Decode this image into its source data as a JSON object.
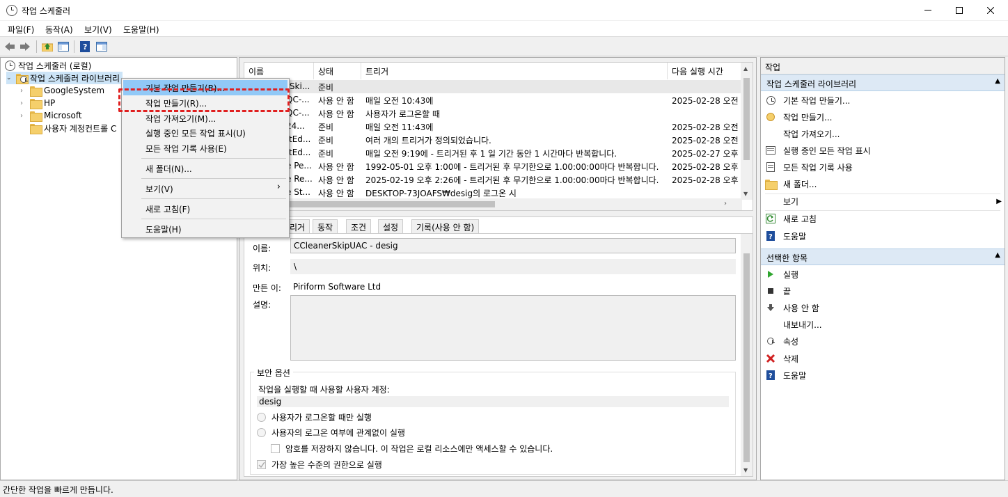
{
  "window": {
    "title": "작업 스케줄러"
  },
  "menu": [
    "파일(F)",
    "동작(A)",
    "보기(V)",
    "도움말(H)"
  ],
  "tree": {
    "root": "작업 스케줄러 (로컬)",
    "library": "작업 스케줄러 라이브러리",
    "children": [
      "GoogleSystem",
      "HP",
      "Microsoft",
      "사용자 계정컨트롤 C"
    ]
  },
  "context_menu": {
    "items": [
      "기본 작업 만들기(B)...",
      "작업 만들기(R)...",
      "작업 가져오기(M)...",
      "실행 중인 모든 작업 표시(U)",
      "모든 작업 기록 사용(E)",
      "새 폴더(N)...",
      "보기(V)",
      "새로 고침(F)",
      "도움말(H)"
    ],
    "submenu_arrow": "›"
  },
  "task_list": {
    "columns": [
      "이름",
      "상태",
      "트리거",
      "다음 실행 시간"
    ],
    "rows": [
      {
        "name": "rSki...",
        "status": "준비",
        "trigger": "",
        "next": ""
      },
      {
        "name": "QC-...",
        "status": "사용 안 함",
        "trigger": "매일 오전 10:43에",
        "next": "2025-02-28 오전"
      },
      {
        "name": "QC-...",
        "status": "사용 안 함",
        "trigger": "사용자가 로그온할 때",
        "next": ""
      },
      {
        "name": "24...",
        "status": "준비",
        "trigger": "매일 오전 11:43에",
        "next": "2025-02-28 오전"
      },
      {
        "name": "ftEd...",
        "status": "준비",
        "trigger": "여러 개의 트리거가 정의되었습니다.",
        "next": "2025-02-28 오전"
      },
      {
        "name": "ftEd...",
        "status": "준비",
        "trigger": "매일 오전 9:19에 - 트리거된 후 1 일 기간 동안 1 시간마다 반복합니다.",
        "next": "2025-02-27 오후"
      },
      {
        "name": "e Pe...",
        "status": "사용 안 함",
        "trigger": "1992-05-01 오후 1:00에 - 트리거된 후 무기한으로 1.00:00:00마다 반복합니다.",
        "next": "2025-02-28 오후"
      },
      {
        "name": "e Re...",
        "status": "사용 안 함",
        "trigger": "2025-02-19 오후 2:26에 - 트리거된 후 무기한으로 1.00:00:00마다 반복합니다.",
        "next": "2025-02-28 오후"
      },
      {
        "name": "e St...",
        "status": "사용 안 함",
        "trigger": "DESKTOP-73JOAFS₩desig의 로그온 시",
        "next": ""
      }
    ]
  },
  "detail_tabs": [
    "리거",
    "동작",
    "조건",
    "설정",
    "기록(사용 안 함)"
  ],
  "details": {
    "name_label": "이름:",
    "name_value": "CCleanerSkipUAC - desig",
    "location_label": "위치:",
    "location_value": "\\",
    "author_label": "만든 이:",
    "author_value": "Piriform Software Ltd",
    "description_label": "설명:",
    "security_title": "보안 옵션",
    "account_label": "작업을 실행할 때 사용할 사용자 계정:",
    "account_value": "desig",
    "radio1": "사용자가 로그온할 때만 실행",
    "radio2": "사용자의 로그온 여부에 관계없이 실행",
    "check1": "암호를 저장하지 않습니다. 이 작업은 로컬 리소스에만 액세스할 수 있습니다.",
    "check2": "가장 높은 수준의 권한으로 실행"
  },
  "actions": {
    "header": "작업",
    "section1": "작업 스케줄러 라이브러리",
    "section1_items": [
      {
        "label": "기본 작업 만들기...",
        "icon": "basic-task-icon"
      },
      {
        "label": "작업 만들기...",
        "icon": "create-task-icon"
      },
      {
        "label": "작업 가져오기...",
        "icon": ""
      },
      {
        "label": "실행 중인 모든 작업 표시",
        "icon": "running-tasks-icon"
      },
      {
        "label": "모든 작업 기록 사용",
        "icon": "history-icon"
      },
      {
        "label": "새 폴더...",
        "icon": "new-folder-icon"
      },
      {
        "label": "보기",
        "icon": ""
      },
      {
        "label": "새로 고침",
        "icon": "refresh-icon"
      },
      {
        "label": "도움말",
        "icon": "help-icon"
      }
    ],
    "section2": "선택한 항목",
    "section2_items": [
      {
        "label": "실행",
        "icon": "run-icon"
      },
      {
        "label": "끝",
        "icon": "stop-icon"
      },
      {
        "label": "사용 안 함",
        "icon": "disable-icon"
      },
      {
        "label": "내보내기...",
        "icon": ""
      },
      {
        "label": "속성",
        "icon": "properties-icon"
      },
      {
        "label": "삭제",
        "icon": "delete-icon"
      },
      {
        "label": "도움말",
        "icon": "help-icon"
      }
    ]
  },
  "status": "간단한 작업을 빠르게 만듭니다.",
  "colors": {
    "highlight": "#91c9f7",
    "section_bg": "#dde9f5",
    "annotation": "#e02020"
  }
}
